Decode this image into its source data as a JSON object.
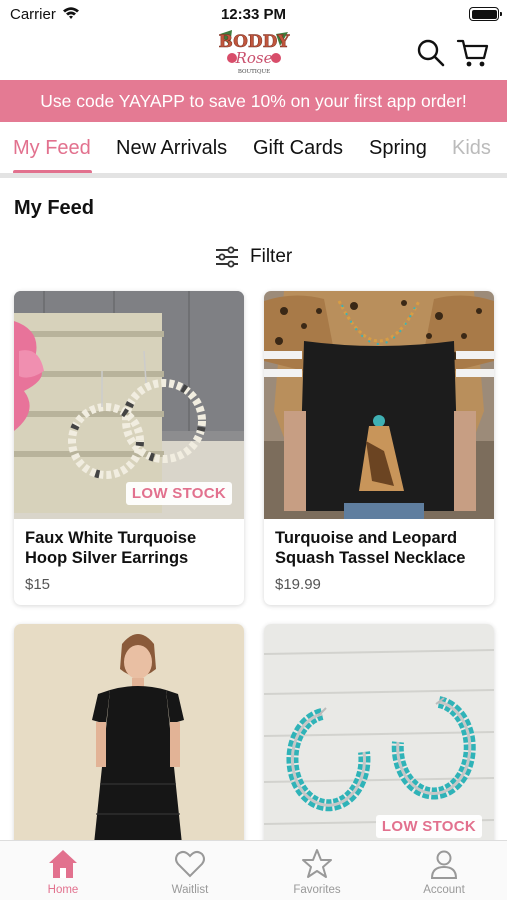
{
  "status_bar": {
    "carrier": "Carrier",
    "time": "12:33 PM"
  },
  "header": {
    "logo_text": "Boddy Rose Boutique"
  },
  "promo": {
    "text": "Use code YAYAPP to save 10% on your first app order!"
  },
  "tabs": [
    {
      "label": "My Feed",
      "active": true
    },
    {
      "label": "New Arrivals"
    },
    {
      "label": "Gift Cards"
    },
    {
      "label": "Spring"
    },
    {
      "label": "Kids"
    }
  ],
  "feed": {
    "title": "My Feed",
    "filter_label": "Filter"
  },
  "products": [
    {
      "name": "Faux White Turquoise Hoop Silver  Earrings",
      "price": "$15",
      "badge": "LOW STOCK"
    },
    {
      "name": "Turquoise and Leopard Squash Tassel Necklace",
      "price": "$19.99",
      "badge": ""
    },
    {
      "name": "",
      "price": "",
      "badge": ""
    },
    {
      "name": "",
      "price": "",
      "badge": "LOW STOCK"
    }
  ],
  "bottom_nav": [
    {
      "label": "Home",
      "icon": "home-icon",
      "active": true
    },
    {
      "label": "Waitlist",
      "icon": "heart-icon"
    },
    {
      "label": "Favorites",
      "icon": "star-icon"
    },
    {
      "label": "Account",
      "icon": "person-icon"
    }
  ],
  "colors": {
    "accent": "#e2718e",
    "promo_bg": "#e47a93",
    "inactive": "#999999"
  }
}
